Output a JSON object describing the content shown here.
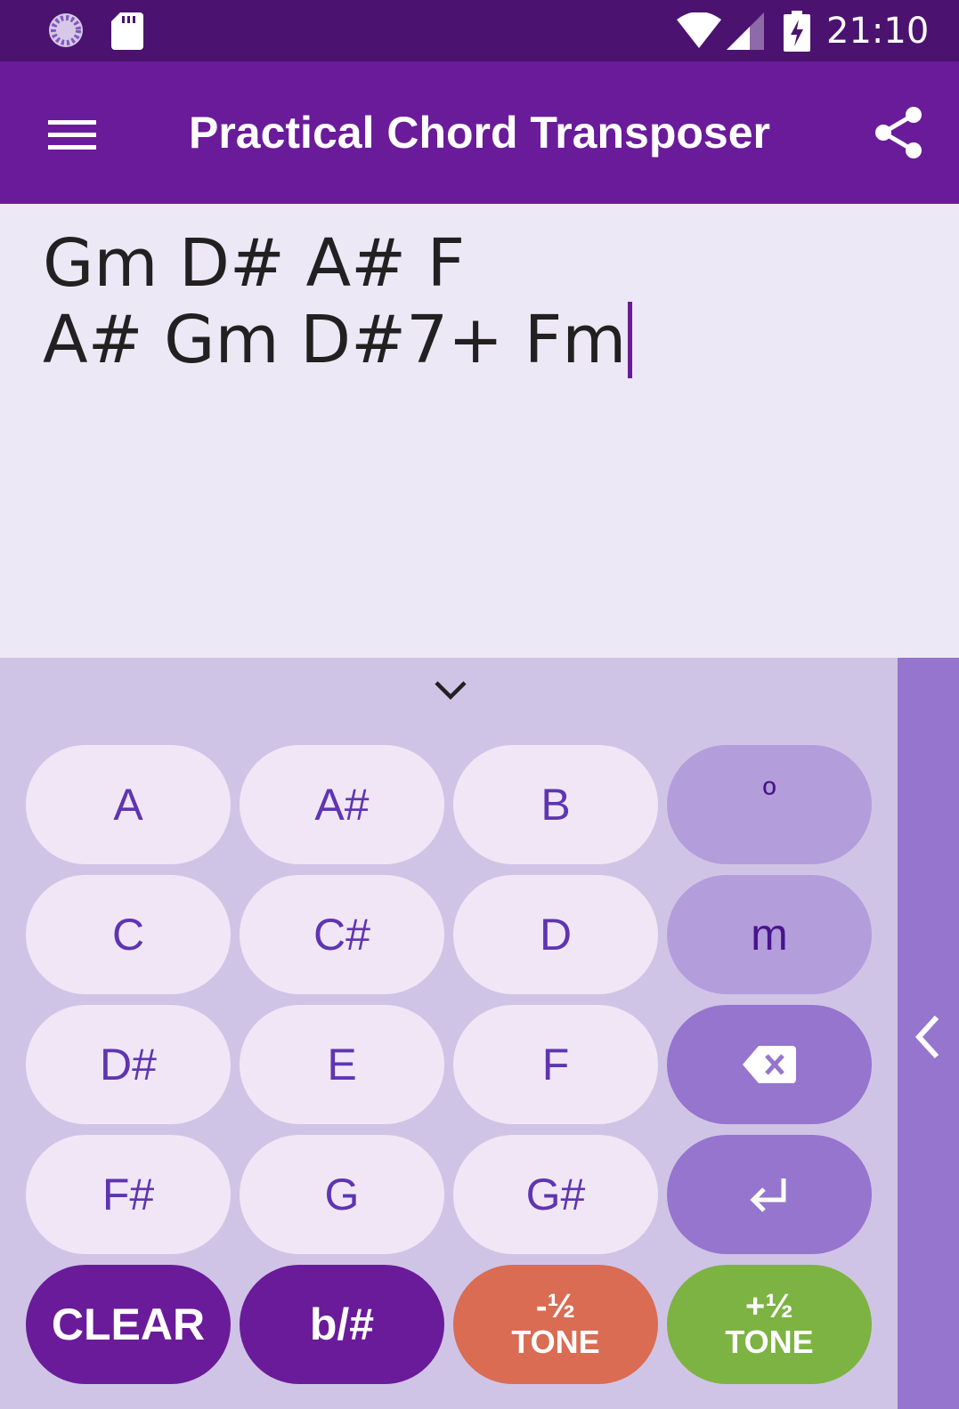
{
  "status_bar": {
    "time": "21:10",
    "icons": [
      "sync-icon",
      "sd-card-icon",
      "wifi-icon",
      "signal-icon",
      "battery-charging-icon"
    ]
  },
  "app_bar": {
    "title": "Practical Chord Transposer",
    "menu_icon": "hamburger-menu-icon",
    "share_icon": "share-icon"
  },
  "editor": {
    "line1": "Gm D# A# F",
    "line2": "A# Gm D#7+ Fm"
  },
  "keyboard": {
    "rows": [
      [
        "A",
        "A#",
        "B",
        "º"
      ],
      [
        "C",
        "C#",
        "D",
        "m"
      ],
      [
        "D#",
        "E",
        "F",
        "backspace"
      ],
      [
        "F#",
        "G",
        "G#",
        "enter"
      ]
    ],
    "clear_label": "CLEAR",
    "flat_sharp_label": "b/#",
    "minus_half_top": "-½",
    "minus_half_bottom": "TONE",
    "plus_half_top": "+½",
    "plus_half_bottom": "TONE"
  },
  "colors": {
    "status_bar": "#4b136f",
    "app_bar": "#6a1b9a",
    "editor_bg": "#ede8f5",
    "keyboard_bg": "#d0c4e6",
    "key_bg": "#f1e6f6",
    "key_text": "#5e35b1",
    "modifier_key": "#b39ddb",
    "action_key": "#9575cd",
    "minus_tone": "#d96c53",
    "plus_tone": "#7cb342"
  }
}
